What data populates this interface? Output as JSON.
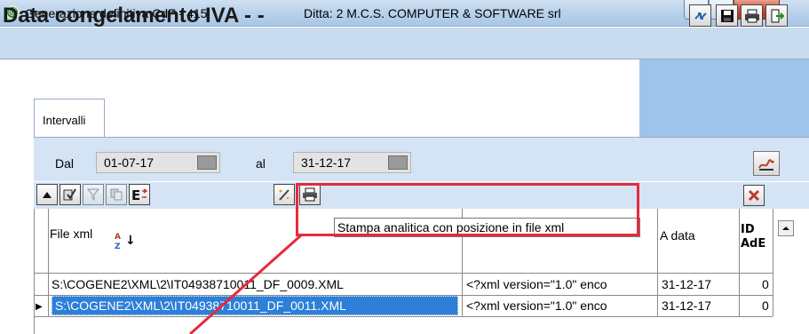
{
  "window": {
    "title": "Generazione definitiva CdF - 415",
    "ditta": "Ditta: 2  M.C.S. COMPUTER & SOFTWARE srl",
    "app_icon_glyph": "@",
    "close_glyph": "x"
  },
  "header": {
    "title": "Data congelamento IVA   -  -",
    "toolbar_icons": [
      "shortcut-icon",
      "save-icon",
      "print-icon",
      "exit-icon"
    ]
  },
  "tabs": [
    {
      "label": "Intervalli"
    }
  ],
  "filter": {
    "dal_label": "Dal",
    "dal_value": "01-07-17",
    "al_label": "al",
    "al_value": "31-12-17"
  },
  "grid_toolbar": {
    "icons": [
      "arrow-up-icon",
      "edit-check-icon",
      "filter-icon",
      "copy-icon",
      "export-icon",
      "magic-wand-icon",
      "print-xml-icon",
      "delete-icon"
    ],
    "tooltip": "Stampa analitica con posizione in file xml"
  },
  "grid": {
    "columns": [
      {
        "label": "File xml"
      },
      {
        "label": ""
      },
      {
        "label": "A data"
      },
      {
        "label": "ID AdE"
      }
    ],
    "rows": [
      {
        "file": "S:\\COGENE2\\XML\\2\\IT04938710011_DF_0009.XML",
        "xml": "<?xml version=\"1.0\" enco",
        "a_data": "31-12-17",
        "id_ade": "0",
        "selected": false
      },
      {
        "file": "S:\\COGENE2\\XML\\2\\IT04938710011_DF_0011.XML",
        "xml": "<?xml version=\"1.0\" enco",
        "a_data": "31-12-17",
        "id_ade": "0",
        "selected": true
      }
    ]
  },
  "annotation_color": "#e52b3c"
}
